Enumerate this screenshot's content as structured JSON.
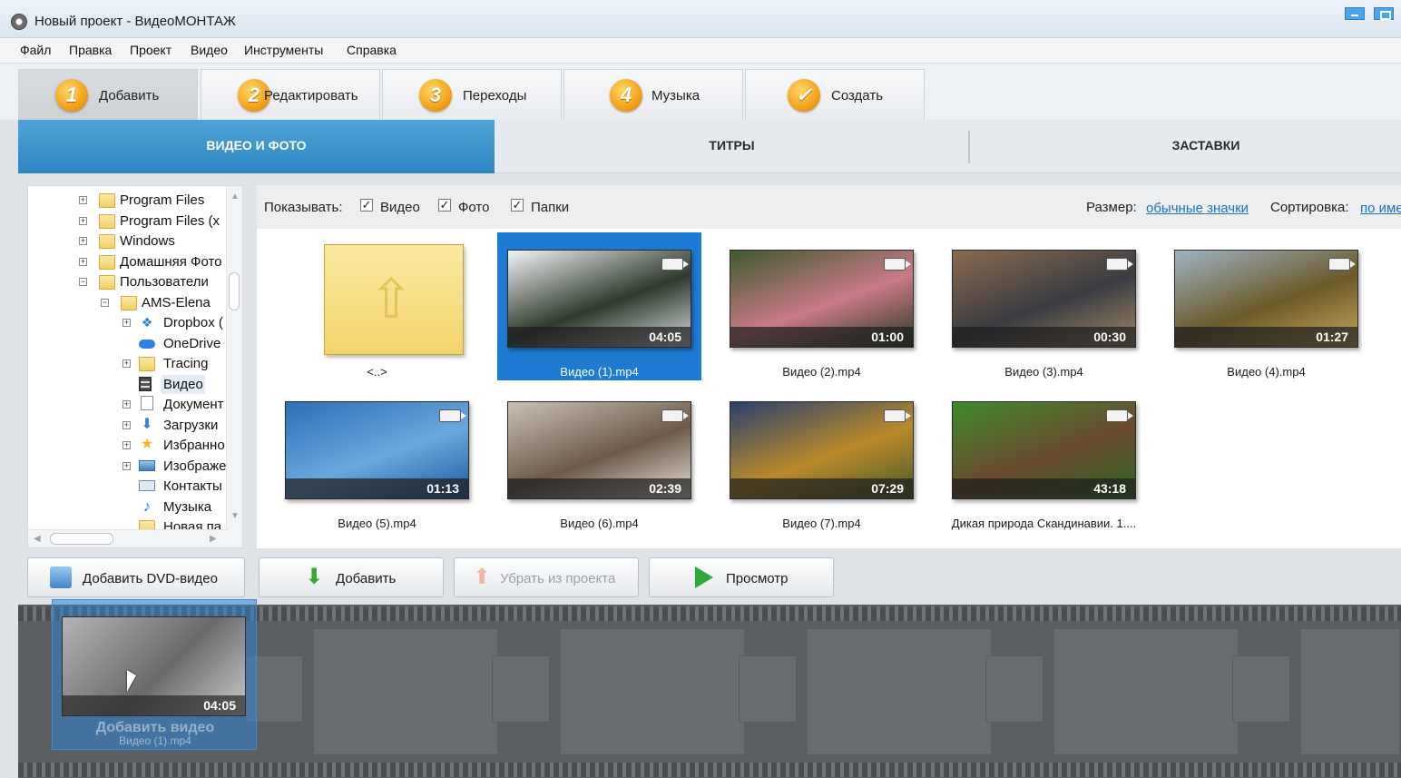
{
  "window": {
    "title": "Новый проект - ВидеоМОНТАЖ"
  },
  "menu": [
    "Файл",
    "Правка",
    "Проект",
    "Видео",
    "Инструменты",
    "Справка"
  ],
  "steps": [
    {
      "num": "1",
      "label": "Добавить",
      "active": true
    },
    {
      "num": "2",
      "label": "Редактировать",
      "active": false
    },
    {
      "num": "3",
      "label": "Переходы",
      "active": false
    },
    {
      "num": "4",
      "label": "Музыка",
      "active": false
    },
    {
      "num": "✓",
      "label": "Создать",
      "active": false
    }
  ],
  "categories": [
    {
      "label": "ВИДЕО И ФОТО",
      "active": true
    },
    {
      "label": "ТИТРЫ",
      "active": false
    },
    {
      "label": "ЗАСТАВКИ",
      "active": false
    }
  ],
  "tree": [
    {
      "label": "Program Files",
      "icon": "folder-icon",
      "expander": "+"
    },
    {
      "label": "Program Files (x",
      "icon": "folder-icon",
      "expander": "+"
    },
    {
      "label": "Windows",
      "icon": "folder-icon",
      "expander": "+"
    },
    {
      "label": "Домашняя Фото",
      "icon": "folder-icon",
      "expander": "+"
    },
    {
      "label": "Пользователи",
      "icon": "folder-icon",
      "expander": "−"
    },
    {
      "label": "AMS-Elena",
      "icon": "folder-icon",
      "expander": "−"
    },
    {
      "label": "Dropbox (",
      "icon": "dropbox-icon",
      "expander": "+"
    },
    {
      "label": "OneDrive",
      "icon": "onedrive-icon",
      "expander": ""
    },
    {
      "label": "Tracing",
      "icon": "folder-icon",
      "expander": "+"
    },
    {
      "label": "Видео",
      "icon": "video-folder-icon",
      "expander": "",
      "selected": true
    },
    {
      "label": "Документ",
      "icon": "documents-icon",
      "expander": "+"
    },
    {
      "label": "Загрузки",
      "icon": "downloads-icon",
      "expander": "+"
    },
    {
      "label": "Избранно",
      "icon": "favorites-icon",
      "expander": "+"
    },
    {
      "label": "Изображе",
      "icon": "pictures-icon",
      "expander": "+"
    },
    {
      "label": "Контакты",
      "icon": "contacts-icon",
      "expander": ""
    },
    {
      "label": "Музыка",
      "icon": "music-icon",
      "expander": ""
    },
    {
      "label": "Новая па",
      "icon": "folder-icon",
      "expander": ""
    }
  ],
  "filter": {
    "show_label": "Показывать:",
    "video": "Видео",
    "photo": "Фото",
    "folders": "Папки",
    "size_label": "Размер:",
    "size_value": "обычные значки",
    "sort_label": "Сортировка:",
    "sort_value": "по име"
  },
  "files": [
    {
      "name": "<..>",
      "type": "up",
      "duration": ""
    },
    {
      "name": "Видео (1).mp4",
      "type": "video",
      "duration": "04:05",
      "selected": true,
      "scene": [
        "#f2f4f6",
        "#2e3a2c",
        "#d9dde0"
      ]
    },
    {
      "name": "Видео (2).mp4",
      "type": "video",
      "duration": "01:00",
      "scene": [
        "#3e5a2e",
        "#c97a86",
        "#2a3a22"
      ]
    },
    {
      "name": "Видео (3).mp4",
      "type": "video",
      "duration": "00:30",
      "scene": [
        "#8a6a4e",
        "#3a3c42",
        "#a08666"
      ]
    },
    {
      "name": "Видео (4).mp4",
      "type": "video",
      "duration": "01:27",
      "scene": [
        "#9fb3c2",
        "#6b5a2a",
        "#caa65a"
      ]
    },
    {
      "name": "Видео (5).mp4",
      "type": "video",
      "duration": "01:13",
      "scene": [
        "#2b6fb8",
        "#6aa7dd",
        "#1f5aa0"
      ]
    },
    {
      "name": "Видео (6).mp4",
      "type": "video",
      "duration": "02:39",
      "scene": [
        "#c9c2b4",
        "#6e5a4a",
        "#e6e2d8"
      ]
    },
    {
      "name": "Видео (7).mp4",
      "type": "video",
      "duration": "07:29",
      "scene": [
        "#2a3f6e",
        "#b98a2a",
        "#4a5a2a"
      ]
    },
    {
      "name": "Дикая природа Скандинавии. 1....",
      "type": "video",
      "duration": "43:18",
      "scene": [
        "#3f8a2e",
        "#6b4a2e",
        "#2f6a22"
      ]
    }
  ],
  "buttons": {
    "add_dvd": "Добавить DVD-видео",
    "add": "Добавить",
    "remove": "Убрать из проекта",
    "preview": "Просмотр"
  },
  "drag": {
    "duration": "04:05",
    "hint": "Добавить видео",
    "file": "Видео (1).mp4"
  },
  "colors": {
    "accent": "#2e86c2",
    "selection": "#1e7bd4",
    "step_badge": "#f3a21a"
  }
}
